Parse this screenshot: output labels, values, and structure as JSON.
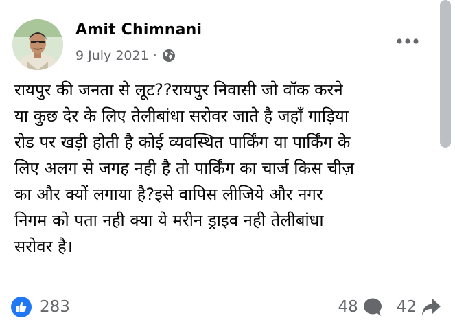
{
  "post": {
    "author": "Amit Chimnani",
    "date": "9 July 2021",
    "separator": "·",
    "audience_icon": "globe-icon",
    "more_icon": "more-dots-icon",
    "text": "रायपुर की जनता से लूट??रायपुर निवासी जो वॉक करने\nया कुछ देर के लिए तेलीबांधा सरोवर जाते है जहाँ गाड़िया\nरोड पर खड़ी होती है कोई व्यवस्थित पार्किंग या पार्किंग के\nलिए अलग से जगह नही है तो पार्किंग का चार्ज किस चीज़\nका और क्यों लगाया है?इसे वापिस लीजिये और नगर\nनिगम को पता नही क्या ये मरीन ड्राइव नही तेलीबांधा\nसरोवर है।"
  },
  "footer": {
    "reaction_icon": "like-icon",
    "reaction_count": "283",
    "comment_count": "48",
    "comment_icon": "comment-bubble-icon",
    "share_count": "42",
    "share_icon": "share-arrow-icon"
  },
  "colors": {
    "like_blue": "#2078f4",
    "meta_gray": "#65676b",
    "text": "#050505"
  }
}
